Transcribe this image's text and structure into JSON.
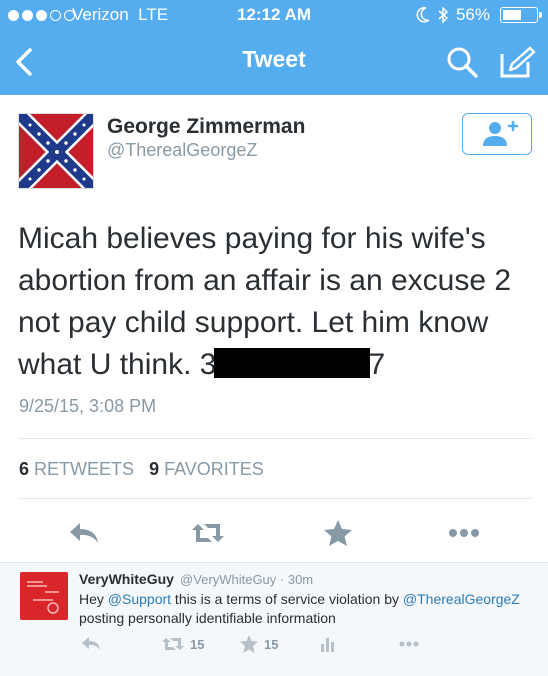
{
  "status_bar": {
    "carrier": "Verizon",
    "network": "LTE",
    "time": "12:12 AM",
    "battery": "56%",
    "battery_level": 0.56
  },
  "nav": {
    "title": "Tweet",
    "back_icon": "chevron-left-icon",
    "search_icon": "search-icon",
    "compose_icon": "compose-icon"
  },
  "tweet": {
    "author_name": "George Zimmerman",
    "author_handle": "@TherealGeorgeZ",
    "text_before_redaction": "Micah believes paying for his wife's abortion from an affair is an excuse 2 not pay child support. Let him know what U think. 3",
    "text_after_redaction": "7",
    "timestamp": "9/25/15, 3:08 PM",
    "retweets_count": "6",
    "retweets_label": "RETWEETS",
    "favorites_count": "9",
    "favorites_label": "FAVORITES"
  },
  "reply": {
    "author_name": "VeryWhiteGuy",
    "author_handle": "@VeryWhiteGuy",
    "time": "· 30m",
    "text_1": "Hey ",
    "mention_1": "@Support",
    "text_2": " this is a terms of service violation by ",
    "mention_2": "@TherealGeorgeZ",
    "text_3": " posting personally identifiable information",
    "retweet_count": "15",
    "favorite_count": "15"
  },
  "colors": {
    "brand": "#55acee",
    "link": "#2b7bb9",
    "muted": "#8899a6",
    "text": "#292f33"
  }
}
